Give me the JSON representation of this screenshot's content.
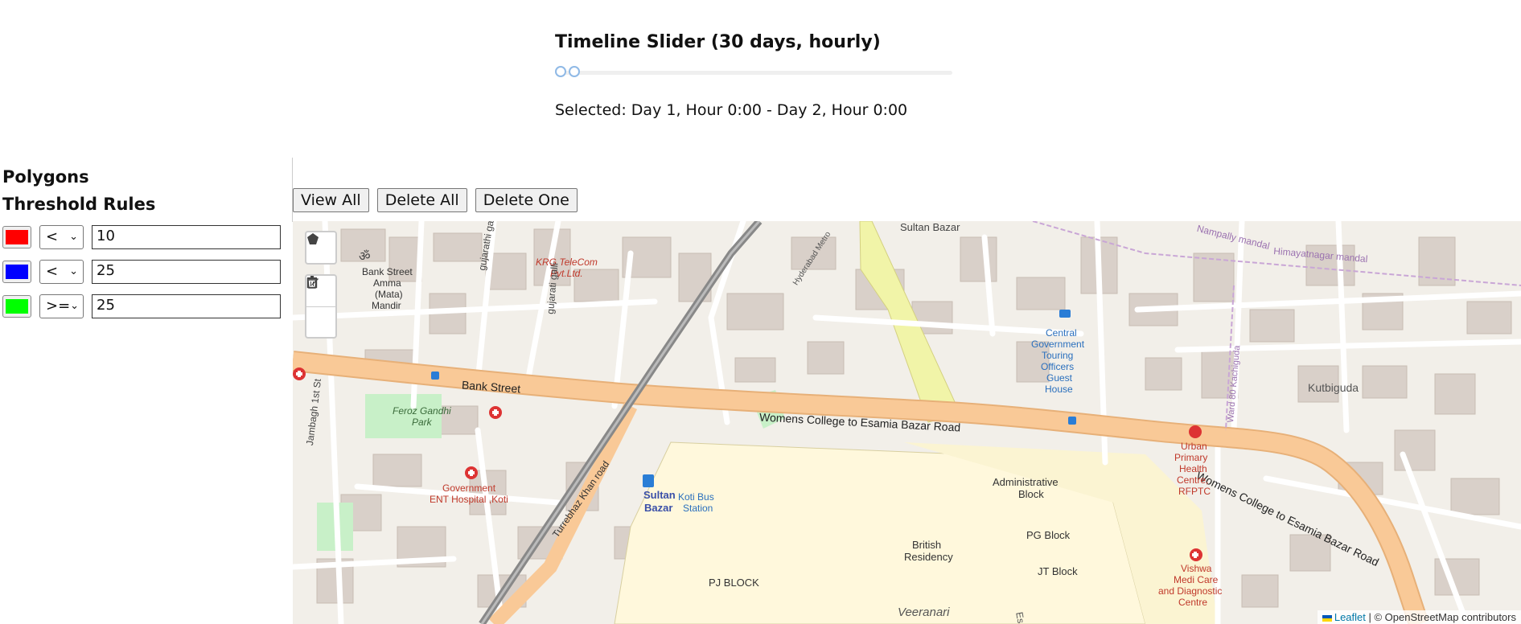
{
  "timeline": {
    "title": "Timeline Slider (30 days, hourly)",
    "range_start_fraction": 0.0,
    "range_end_fraction": 0.034,
    "selected_text": "Selected: Day 1, Hour 0:00 - Day 2, Hour 0:00"
  },
  "sidebar": {
    "polygons_heading": "Polygons",
    "rules_heading": "Threshold Rules",
    "rules": [
      {
        "color": "#ff0000",
        "operator": "<",
        "value": "10"
      },
      {
        "color": "#0000ff",
        "operator": "<",
        "value": "25"
      },
      {
        "color": "#00ff00",
        "operator": ">=",
        "value": "25"
      }
    ]
  },
  "toolbar": {
    "view_all": "View All",
    "delete_all": "Delete All",
    "delete_one": "Delete One"
  },
  "map": {
    "draw_controls": [
      "polygon-icon",
      "edit-icon",
      "trash-icon"
    ],
    "labels": {
      "sultan_bazar_top": "Sultan Bazar",
      "krg_1": "KRG TeleCom",
      "krg_2": "Pvt.Ltd.",
      "gujarathi": "gujarathi galli",
      "gujarati": "gujarati galli",
      "temple_1": "Bank Street",
      "temple_2": "Amma",
      "temple_3": "(Mata)",
      "temple_4": "Mandir",
      "bank_street": "Bank Street",
      "jambagh": "Jambagh 1st St",
      "feroz_1": "Feroz Gandhi",
      "feroz_2": "Park",
      "govt_1": "Government",
      "govt_2": "ENT Hospital ,Koti",
      "womens_college": "Womens College to Esamia Bazar Road",
      "womens_college_2": "Womens College to Esamia Bazar Road",
      "sultan_1": "Sultan",
      "sultan_2": "Bazar",
      "koti_1": "Koti Bus",
      "koti_2": "Station",
      "turrebhaz": "Turrebhaz Khan road",
      "pj_block": "PJ BLOCK",
      "british_1": "British",
      "british_2": "Residency",
      "veeranari": "Veeranari",
      "admin_1": "Administrative",
      "admin_2": "Block",
      "pg_block": "PG Block",
      "jt_block": "JT Block",
      "cgto_1": "Central",
      "cgto_2": "Government",
      "cgto_3": "Touring",
      "cgto_4": "Officers",
      "cgto_5": "Guest",
      "cgto_6": "House",
      "urban_1": "Urban",
      "urban_2": "Primary",
      "urban_3": "Health",
      "urban_4": "Centre,",
      "urban_5": "RFPTC",
      "kutbiguda": "Kutbiguda",
      "ward": "Ward 80 Kachiguda",
      "nampally": "Nampally mandal",
      "himayatnagar": "Himayatnagar mandal",
      "hyderabad_metro": "Hyderabad Metro",
      "vishwa_1": "Vishwa",
      "vishwa_2": "Medi Care",
      "vishwa_3": "and Diagnostic",
      "vishwa_4": "Centre",
      "es": "Es"
    },
    "attribution_leaflet": "Leaflet",
    "attribution_rest": " | © OpenStreetMap contributors"
  }
}
